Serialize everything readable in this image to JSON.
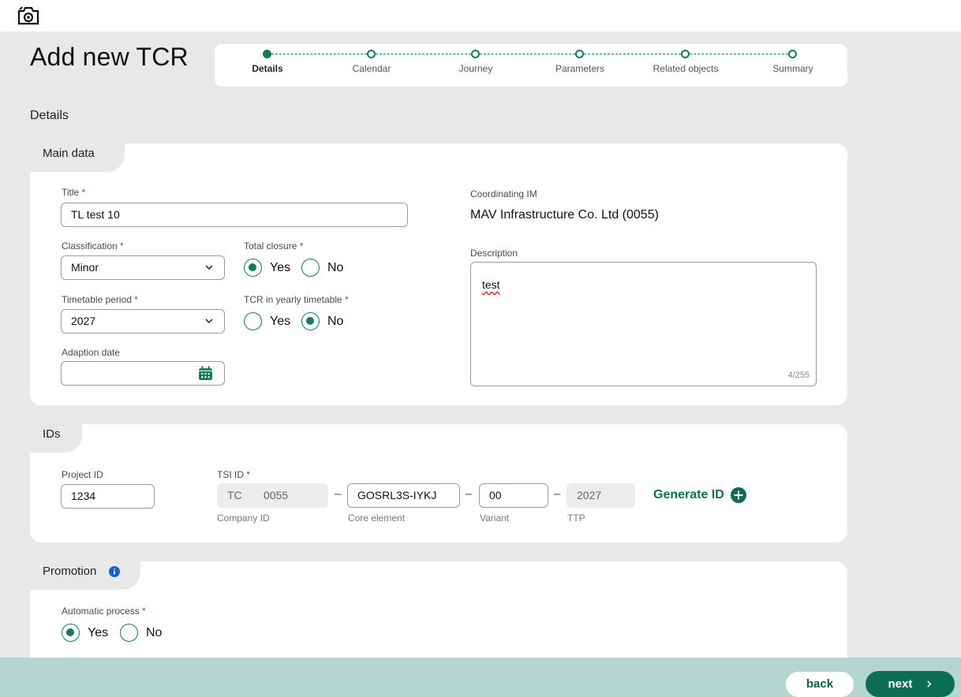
{
  "page": {
    "title": "Add new TCR",
    "section": "Details"
  },
  "stepper": {
    "steps": [
      {
        "label": "Details",
        "state": "active"
      },
      {
        "label": "Calendar",
        "state": "pending"
      },
      {
        "label": "Journey",
        "state": "pending"
      },
      {
        "label": "Parameters",
        "state": "pending"
      },
      {
        "label": "Related objects",
        "state": "pending"
      },
      {
        "label": "Summary",
        "state": "pending"
      }
    ]
  },
  "main_data": {
    "tab": "Main data",
    "title_label": "Title",
    "title_value": "TL test 10",
    "classification_label": "Classification",
    "classification_value": "Minor",
    "total_closure_label": "Total closure",
    "total_closure_yes": "Yes",
    "total_closure_no": "No",
    "total_closure_selected": "Yes",
    "timetable_label": "Timetable period",
    "timetable_value": "2027",
    "yearly_label": "TCR in yearly timetable",
    "yearly_yes": "Yes",
    "yearly_no": "No",
    "yearly_selected": "No",
    "adaption_label": "Adaption date",
    "adaption_value": "",
    "coordinating_label": "Coordinating IM",
    "coordinating_value": "MAV Infrastructure Co. Ltd (0055)",
    "description_label": "Description",
    "description_value": "test",
    "description_counter": "4/255"
  },
  "ids": {
    "tab": "IDs",
    "project_label": "Project ID",
    "project_value": "1234",
    "tsi_label": "TSI ID",
    "company_prefix": "TC",
    "company_value": "0055",
    "company_helper": "Company ID",
    "core_value": "GOSRL3S-IYKJ",
    "core_helper": "Core element",
    "variant_value": "00",
    "variant_helper": "Variant",
    "ttp_value": "2027",
    "ttp_helper": "TTP",
    "dash": "–",
    "generate_label": "Generate ID"
  },
  "promotion": {
    "tab": "Promotion",
    "auto_label": "Automatic process",
    "yes": "Yes",
    "no": "No",
    "selected": "Yes"
  },
  "footer": {
    "back": "back",
    "next": "next"
  },
  "colors": {
    "accent": "#147a5e",
    "footer": "#b3d7cf",
    "required": "#d12c2c",
    "info": "#1a5fd1"
  }
}
